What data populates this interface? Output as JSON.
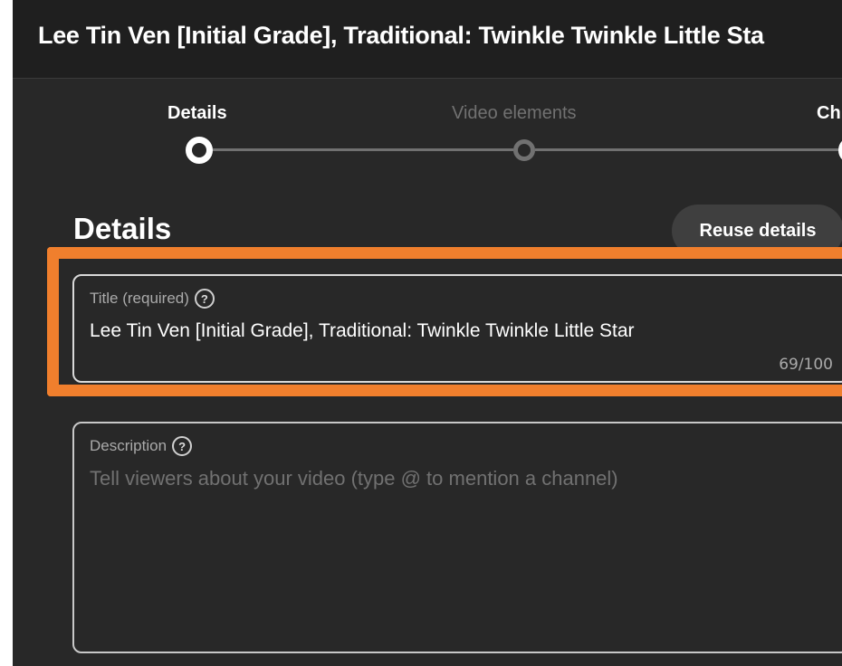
{
  "header": {
    "title": "Lee Tin Ven [Initial Grade], Traditional: Twinkle Twinkle Little Sta"
  },
  "stepper": {
    "steps": [
      {
        "label": "Details",
        "state": "active"
      },
      {
        "label": "Video elements",
        "state": "inactive"
      },
      {
        "label": "Ch",
        "state": "active"
      }
    ]
  },
  "details": {
    "section_title": "Details",
    "reuse_button_label": "Reuse details",
    "title_field": {
      "label": "Title (required)",
      "value": "Lee Tin Ven [Initial Grade], Traditional: Twinkle Twinkle Little Star",
      "char_count": "69/100",
      "help_icon": "question-circle-icon"
    },
    "description_field": {
      "label": "Description",
      "placeholder": "Tell viewers about your video (type @ to mention a channel)",
      "help_icon": "question-circle-icon"
    }
  },
  "colors": {
    "background": "#282828",
    "header": "#1f1f1f",
    "highlight": "#f07f2d",
    "inactive": "#717171"
  }
}
